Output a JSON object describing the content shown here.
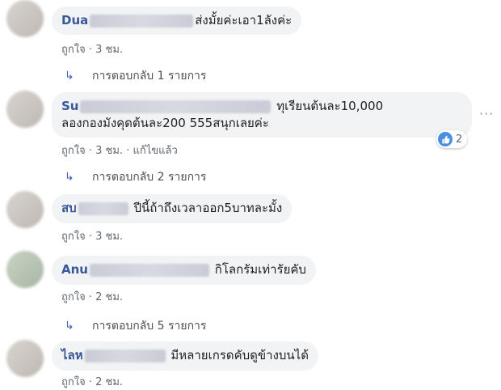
{
  "comments": [
    {
      "name": "Dua",
      "text": "ส่งมั้ยค่ะเอา1ลังค่ะ",
      "like_label": "ถูกใจ",
      "time": "3 ชม.",
      "replies": "การตอบกลับ 1 รายการ"
    },
    {
      "name": "Su",
      "text_line1": "ทุเรียนต้นละ10,000",
      "text_line2": "ลองกองมังคุดต้นละ200 555สนุกเลยค่ะ",
      "like_label": "ถูกใจ",
      "time": "3 ชม.",
      "edited": "แก้ไขแล้ว",
      "reaction_count": "2",
      "replies": "การตอบกลับ 2 รายการ"
    },
    {
      "name": "สบ",
      "text": "ปีนี้ถ้าถึงเวลาออก5บาทละมั้ง",
      "like_label": "ถูกใจ",
      "time": "3 ชม."
    },
    {
      "name": "Anu",
      "text": "กิโลกรัมเท่ารัยคับ",
      "like_label": "ถูกใจ",
      "time": "2 ชม.",
      "replies": "การตอบกลับ 5 รายการ"
    },
    {
      "name": "ไลห",
      "text": "มีหลายเกรดคับดูข้างบนได้",
      "like_label": "ถูกใจ",
      "time": "2 ชม."
    }
  ],
  "separator": "·",
  "icons": {
    "reply": "reply-arrow-icon",
    "like": "thumbs-up-icon",
    "more": "more-options-icon"
  },
  "colors": {
    "name": "#385898",
    "bubble": "#f2f3f5",
    "like_badge": "#4a90e2"
  }
}
